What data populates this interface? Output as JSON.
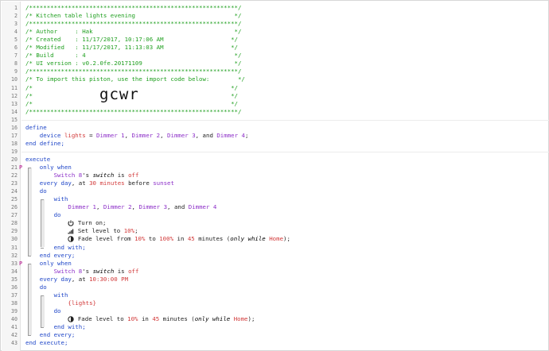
{
  "lines": [
    {
      "n": "1",
      "t": [
        [
          "/***********************************************************/",
          "cmt"
        ]
      ]
    },
    {
      "n": "2",
      "t": [
        [
          "/* Kitchen table lights evening                            */",
          "cmt"
        ]
      ]
    },
    {
      "n": "3",
      "t": [
        [
          "/***********************************************************/",
          "cmt"
        ]
      ]
    },
    {
      "n": "4",
      "t": [
        [
          "/* Author     : Hak                                        */",
          "cmt"
        ]
      ]
    },
    {
      "n": "5",
      "t": [
        [
          "/* Created    : 11/17/2017, 10:17:06 AM                   */",
          "cmt"
        ]
      ]
    },
    {
      "n": "6",
      "t": [
        [
          "/* Modified   : 11/17/2017, 11:13:03 AM                   */",
          "cmt"
        ]
      ]
    },
    {
      "n": "7",
      "t": [
        [
          "/* Build      : 4                                          */",
          "cmt"
        ]
      ]
    },
    {
      "n": "8",
      "t": [
        [
          "/* UI version : v0.2.0fe.20171109                          */",
          "cmt"
        ]
      ]
    },
    {
      "n": "9",
      "t": [
        [
          "/***********************************************************/",
          "cmt"
        ]
      ]
    },
    {
      "n": "10",
      "t": [
        [
          "/* To import this piston, use the import code below:        */",
          "cmt"
        ]
      ]
    },
    {
      "n": "11",
      "t": [
        [
          "/*                                                        */",
          "cmt"
        ]
      ]
    },
    {
      "n": "12",
      "t": [
        [
          "/*                                                        */",
          "cmt"
        ]
      ]
    },
    {
      "n": "13",
      "t": [
        [
          "/*                                                        */",
          "cmt"
        ]
      ]
    },
    {
      "n": "14",
      "t": [
        [
          "/***********************************************************/",
          "cmt"
        ]
      ]
    },
    {
      "n": "15",
      "t": []
    },
    {
      "n": "16",
      "t": [
        [
          "define",
          "kw"
        ]
      ]
    },
    {
      "n": "17",
      "t": [
        [
          "    device ",
          "kw"
        ],
        [
          "lights",
          "var"
        ],
        [
          " = ",
          "pl"
        ],
        [
          "Dimmer 1",
          "dev"
        ],
        [
          ", ",
          "pl"
        ],
        [
          "Dimmer 2",
          "dev"
        ],
        [
          ", ",
          "pl"
        ],
        [
          "Dimmer 3",
          "dev"
        ],
        [
          ", and ",
          "pl"
        ],
        [
          "Dimmer 4",
          "dev"
        ],
        [
          ";",
          "pl"
        ]
      ]
    },
    {
      "n": "18",
      "t": [
        [
          "end define;",
          "kw"
        ]
      ]
    },
    {
      "n": "19",
      "t": []
    },
    {
      "n": "20",
      "t": [
        [
          "execute",
          "kw"
        ]
      ]
    },
    {
      "n": "21",
      "t": [
        [
          "    only when",
          "kw"
        ]
      ],
      "flag": "P"
    },
    {
      "n": "22",
      "t": [
        [
          "        ",
          "pl"
        ],
        [
          "Switch 8",
          "dev"
        ],
        [
          "'s ",
          "pl"
        ],
        [
          "switch",
          "it"
        ],
        [
          " is ",
          "pl"
        ],
        [
          "off",
          "var"
        ]
      ]
    },
    {
      "n": "23",
      "t": [
        [
          "    every day",
          "kw"
        ],
        [
          ", at ",
          "pl"
        ],
        [
          "30",
          "num"
        ],
        [
          " ",
          "pl"
        ],
        [
          "minutes",
          "var"
        ],
        [
          " before ",
          "pl"
        ],
        [
          "sunset",
          "dev"
        ]
      ]
    },
    {
      "n": "24",
      "t": [
        [
          "    do",
          "kw"
        ]
      ]
    },
    {
      "n": "25",
      "t": [
        [
          "        with",
          "kw"
        ]
      ]
    },
    {
      "n": "26",
      "t": [
        [
          "            ",
          "pl"
        ],
        [
          "Dimmer 1",
          "dev"
        ],
        [
          ", ",
          "pl"
        ],
        [
          "Dimmer 2",
          "dev"
        ],
        [
          ", ",
          "pl"
        ],
        [
          "Dimmer 3",
          "dev"
        ],
        [
          ", and ",
          "pl"
        ],
        [
          "Dimmer 4",
          "dev"
        ]
      ]
    },
    {
      "n": "27",
      "t": [
        [
          "        do",
          "kw"
        ]
      ]
    },
    {
      "n": "28",
      "t": [
        [
          "            ",
          "pl"
        ],
        [
          "@power",
          "icon"
        ],
        [
          " Turn on;",
          "pl"
        ]
      ]
    },
    {
      "n": "29",
      "t": [
        [
          "            ",
          "pl"
        ],
        [
          "@level",
          "icon"
        ],
        [
          " Set level to ",
          "pl"
        ],
        [
          "10%",
          "num"
        ],
        [
          ";",
          "pl"
        ]
      ]
    },
    {
      "n": "30",
      "t": [
        [
          "            ",
          "pl"
        ],
        [
          "@fade",
          "icon"
        ],
        [
          " Fade level from ",
          "pl"
        ],
        [
          "10%",
          "num"
        ],
        [
          " to ",
          "pl"
        ],
        [
          "100%",
          "num"
        ],
        [
          " in ",
          "pl"
        ],
        [
          "45",
          "num"
        ],
        [
          " minutes (",
          "pl"
        ],
        [
          "only while ",
          "it"
        ],
        [
          "Home",
          "str"
        ],
        [
          ");",
          "pl"
        ]
      ]
    },
    {
      "n": "31",
      "t": [
        [
          "        end with;",
          "kw"
        ]
      ]
    },
    {
      "n": "32",
      "t": [
        [
          "    end every;",
          "kw"
        ]
      ]
    },
    {
      "n": "33",
      "t": [
        [
          "    only when",
          "kw"
        ]
      ],
      "flag": "P"
    },
    {
      "n": "34",
      "t": [
        [
          "        ",
          "pl"
        ],
        [
          "Switch 8",
          "dev"
        ],
        [
          "'s ",
          "pl"
        ],
        [
          "switch",
          "it"
        ],
        [
          " is ",
          "pl"
        ],
        [
          "off",
          "var"
        ]
      ]
    },
    {
      "n": "35",
      "t": [
        [
          "    every day",
          "kw"
        ],
        [
          ", at ",
          "pl"
        ],
        [
          "10:30:00 PM",
          "num"
        ]
      ]
    },
    {
      "n": "36",
      "t": [
        [
          "    do",
          "kw"
        ]
      ]
    },
    {
      "n": "37",
      "t": [
        [
          "        with",
          "kw"
        ]
      ]
    },
    {
      "n": "38",
      "t": [
        [
          "            ",
          "pl"
        ],
        [
          "{lights}",
          "var"
        ]
      ]
    },
    {
      "n": "39",
      "t": [
        [
          "        do",
          "kw"
        ]
      ]
    },
    {
      "n": "40",
      "t": [
        [
          "            ",
          "pl"
        ],
        [
          "@fade",
          "icon"
        ],
        [
          " Fade level to ",
          "pl"
        ],
        [
          "10%",
          "num"
        ],
        [
          " in ",
          "pl"
        ],
        [
          "45",
          "num"
        ],
        [
          " minutes (",
          "pl"
        ],
        [
          "only while ",
          "it"
        ],
        [
          "Home",
          "str"
        ],
        [
          ");",
          "pl"
        ]
      ]
    },
    {
      "n": "41",
      "t": [
        [
          "        end with;",
          "kw"
        ]
      ]
    },
    {
      "n": "42",
      "t": [
        [
          "    end every;",
          "kw"
        ]
      ]
    },
    {
      "n": "43",
      "t": [
        [
          "end execute;",
          "kw"
        ]
      ]
    }
  ],
  "import_code": "gcwr",
  "icons": {
    "power": "power-icon",
    "level": "signal-level-icon",
    "fade": "fade-icon"
  }
}
